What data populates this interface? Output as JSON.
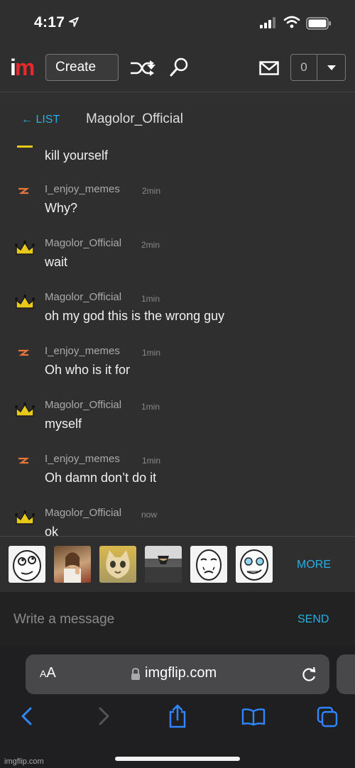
{
  "status": {
    "time": "4:17"
  },
  "nav": {
    "logo_i": "i",
    "logo_m": "m",
    "create_label": "Create",
    "notif_count": "0"
  },
  "chat": {
    "back_label": "LIST",
    "title": "Magolor_Official"
  },
  "messages": [
    {
      "text": "kill yourself"
    },
    {
      "sender": "I_enjoy_memes",
      "time": "2min",
      "text": "Why?",
      "avatar": "lightning-icon"
    },
    {
      "sender": "Magolor_Official",
      "time": "2min",
      "text": "wait",
      "avatar": "crown-icon"
    },
    {
      "sender": "Magolor_Official",
      "time": "1min",
      "text": "oh my god this is the wrong guy",
      "avatar": "crown-icon"
    },
    {
      "sender": "I_enjoy_memes",
      "time": "1min",
      "text": "Oh who is it for",
      "avatar": "lightning-icon"
    },
    {
      "sender": "Magolor_Official",
      "time": "1min",
      "text": "myself",
      "avatar": "crown-icon"
    },
    {
      "sender": "I_enjoy_memes",
      "time": "1min",
      "text": "Oh damn don’t do it",
      "avatar": "lightning-icon"
    },
    {
      "sender": "Magolor_Official",
      "time": "now",
      "text": "ok",
      "avatar": "crown-icon"
    }
  ],
  "meme_bar": {
    "more_label": "MORE"
  },
  "composer": {
    "placeholder": "Write a message",
    "send_label": "SEND"
  },
  "browser": {
    "aa_small": "A",
    "aa_large": "A",
    "url": "imgflip.com"
  },
  "watermark": "imgflip.com",
  "colors": {
    "accent": "#29aee0",
    "brand_red": "#e8282d",
    "crown": "#e8c81a",
    "lightning": "#e8753a"
  }
}
